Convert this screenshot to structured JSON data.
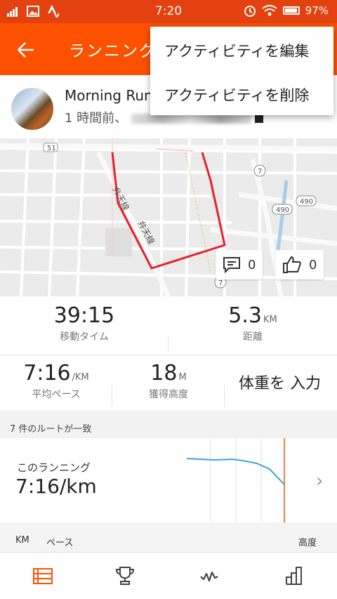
{
  "status_bar": {
    "time": "7:20",
    "battery": "97%"
  },
  "toolbar": {
    "title": "ランニング"
  },
  "activity": {
    "name": "Morning Run",
    "time_ago": "1 時間前、"
  },
  "map": {
    "comments": "0",
    "kudos": "0",
    "shields": [
      "51",
      "7",
      "490",
      "490",
      "7"
    ],
    "street_labels": [
      "弁天線",
      "弁天線"
    ]
  },
  "stats": {
    "moving_time": {
      "value": "39:15",
      "label": "移動タイム"
    },
    "distance": {
      "value": "5.3",
      "unit": "KM",
      "label": "距離"
    },
    "avg_pace": {
      "value": "7:16",
      "unit": "/KM",
      "label": "平均ペース"
    },
    "elevation": {
      "value": "18",
      "unit": "M",
      "label": "獲得高度"
    },
    "weight_action": "体重を 入力"
  },
  "routes": {
    "header": "7 件のルートが一致",
    "this_run_label": "このランニング",
    "this_run_pace": "7:16/km"
  },
  "splits": {
    "col_km": "KM",
    "col_pace": "ペース",
    "col_elev": "高度"
  },
  "menu": {
    "edit": "アクティビティを編集",
    "delete": "アクティビティを削除"
  },
  "colors": {
    "brand": "#fc5200",
    "route_line": "#e8202a",
    "chart_line": "#3aa6dd",
    "chart_marker": "#fc5200"
  }
}
